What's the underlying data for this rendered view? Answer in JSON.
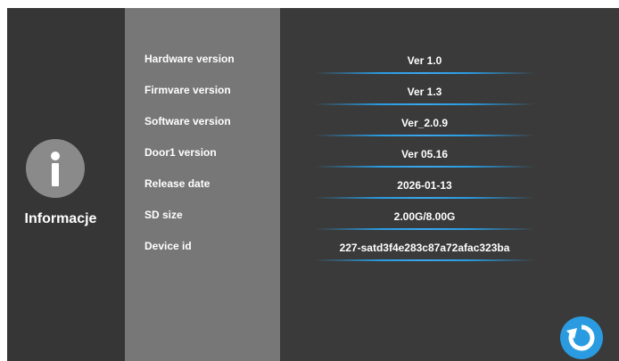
{
  "page": {
    "title": "Informacje",
    "info_icon": "info-icon",
    "refresh_icon": "refresh-icon",
    "accent_color": "#2a9be0"
  },
  "rows": [
    {
      "label": "Hardware version",
      "value": "Ver 1.0"
    },
    {
      "label": "Firmvare version",
      "value": "Ver 1.3"
    },
    {
      "label": "Software version",
      "value": "Ver_2.0.9"
    },
    {
      "label": "Door1 version",
      "value": "Ver 05.16"
    },
    {
      "label": "Release date",
      "value": "2026-01-13"
    },
    {
      "label": "SD size",
      "value": "2.00G/8.00G"
    },
    {
      "label": "Device id",
      "value": "227-satd3f4e283c87a72afac323ba"
    }
  ]
}
